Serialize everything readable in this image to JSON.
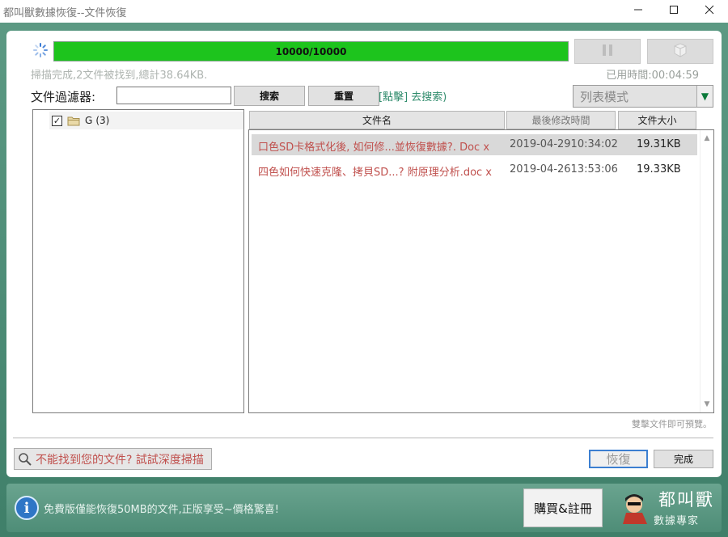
{
  "window": {
    "title": "都叫獸數據恢復--文件恢復",
    "minimize_icon": "minimize-icon",
    "maximize_icon": "maximize-icon",
    "close_icon": "close-icon"
  },
  "scan": {
    "progress_fraction": 1.0,
    "progress_text": "10000/10000",
    "status_text": "掃描完成,2文件被找到,總計38.64KB.",
    "elapsed_text": "已用時間:00:04:59",
    "pause_icon": "pause-icon",
    "stop_icon": "stop-icon",
    "accent_color": "#1dc41d"
  },
  "filter": {
    "label": "文件過濾器:",
    "input_value": "",
    "search_label": "搜索",
    "reset_label": "重置",
    "hint_link": "[點擊] 去搜索)"
  },
  "view": {
    "selected": "列表模式",
    "dropdown_icon": "chevron-down-icon"
  },
  "tree": {
    "items": [
      {
        "label": "G",
        "count": "(3)",
        "checked": true
      }
    ]
  },
  "table": {
    "headers": {
      "name": "文件名",
      "modified": "最後修改時間",
      "size": "文件大小"
    },
    "rows": [
      {
        "name": "口色SD卡格式化後, 如何修...並恢復數據?. Doc x",
        "modified": "2019-04-2910:34:02",
        "size": "19.31KB",
        "selected": true
      },
      {
        "name": "四色如何快速克隆、拷貝SD...? 附原理分析.doc x",
        "modified": "2019-04-2613:53:06",
        "size": "19.33KB",
        "selected": false
      }
    ],
    "preview_hint": "雙擊文件即可預覽。"
  },
  "actions": {
    "deep_scan_label": "不能找到您的文件? 試試深度掃描",
    "recover_label": "恢復",
    "done_label": "完成"
  },
  "footer": {
    "info_text": "免費版僅能恢復50MB的文件,正版享受~價格驚喜!",
    "buy_label": "購買&註冊",
    "brand_name": "都叫獸",
    "brand_tm": "™",
    "brand_subtitle": "數據專家"
  }
}
